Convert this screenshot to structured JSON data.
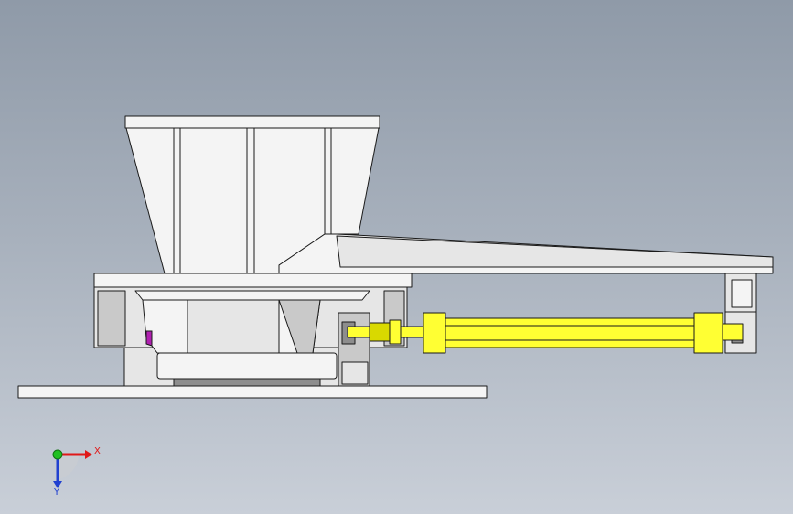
{
  "triad": {
    "x_label": "X",
    "y_label": "Y",
    "x_color": "#e01818",
    "y_color": "#2040d0",
    "origin_color": "#20c020"
  },
  "colors": {
    "cylinder": "#ffff33",
    "body": "#f4f4f4",
    "accent": "#b020b0"
  }
}
